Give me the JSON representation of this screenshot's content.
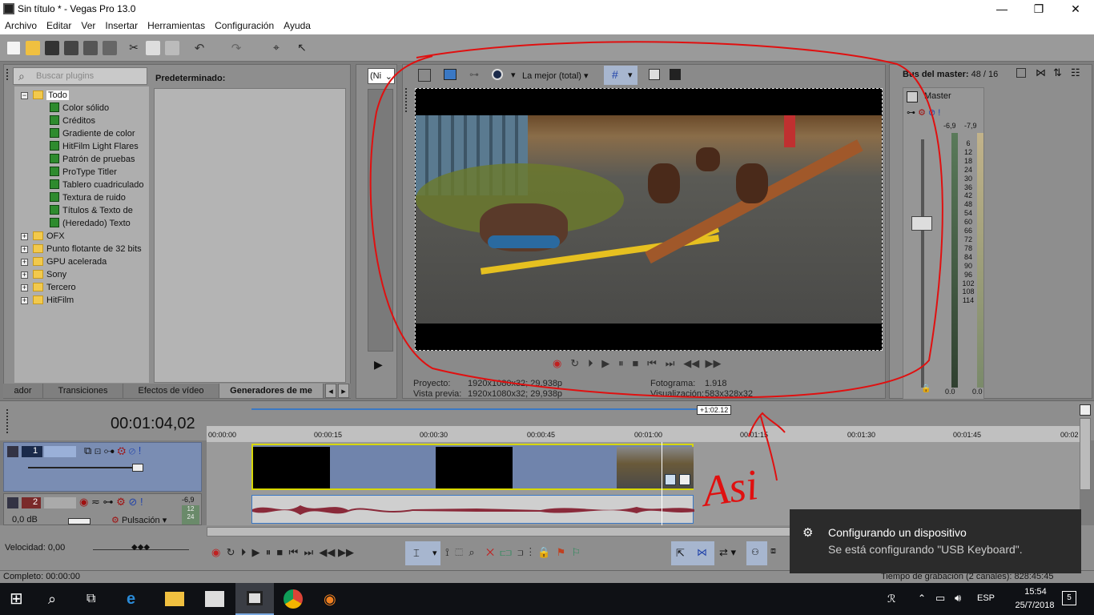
{
  "window": {
    "title": "Sin título * - Vegas Pro 13.0"
  },
  "menu": [
    "Archivo",
    "Editar",
    "Ver",
    "Insertar",
    "Herramientas",
    "Configuración",
    "Ayuda"
  ],
  "explorer": {
    "search_placeholder": "Buscar plugins",
    "preset_label": "Predeterminado:",
    "tree": {
      "root": "Todo",
      "children": [
        "Color sólido",
        "Créditos",
        "Gradiente de color",
        "HitFilm Light Flares",
        "Patrón de pruebas",
        "ProType Titler",
        "Tablero cuadriculado",
        "Textura de ruido",
        "Títulos & Texto de",
        "(Heredado) Texto"
      ],
      "folders": [
        "OFX",
        "Punto flotante de 32 bits",
        "GPU acelerada",
        "Sony",
        "Tercero",
        "HitFilm"
      ]
    },
    "tabs": [
      "ador",
      "Transiciones",
      "Efectos de vídeo",
      "Generadores de me"
    ]
  },
  "trimmer": {
    "dropdown": "(Ni"
  },
  "preview": {
    "quality": "La mejor (total)",
    "proyecto_label": "Proyecto:",
    "proyecto_value": "1920x1080x32; 29,938p",
    "vista_label": "Vista previa:",
    "vista_value": "1920x1080x32; 29,938p",
    "fotograma_label": "Fotograma:",
    "fotograma_value": "1.918",
    "visualizacion_label": "Visualización:",
    "visualizacion_value": "583x328x32"
  },
  "master": {
    "title": "Bus del master:",
    "count": "48 / 16",
    "label": "Master",
    "peak_l": "-6,9",
    "peak_r": "-7,9",
    "scale": [
      "6",
      "12",
      "18",
      "24",
      "30",
      "36",
      "42",
      "48",
      "54",
      "60",
      "66",
      "72",
      "78",
      "84",
      "90",
      "96",
      "102",
      "108",
      "114"
    ],
    "bottom_l": "0.0",
    "bottom_r": "0.0"
  },
  "timeline": {
    "timecode": "00:01:04,02",
    "loop_badge": "+1:02.12",
    "ruler": [
      "00:00:00",
      "00:00:15",
      "00:00:30",
      "00:00:45",
      "00:01:00",
      "00:01:15",
      "00:01:30",
      "00:01:45",
      "00:02"
    ],
    "track1_num": "1",
    "track2_num": "2",
    "track2_vol": "0,0 dB",
    "track2_pan": "Pulsación",
    "track2_meter": "-6,9",
    "track2_m1": "12",
    "track2_m2": "24"
  },
  "bottom": {
    "velocidad": "Velocidad: 0,00",
    "completo": "Completo: 00:00:00",
    "grabacion": "Tiempo de grabación (2 canales): 828:45:45"
  },
  "toast": {
    "title": "Configurando un dispositivo",
    "body": "Se está configurando \"USB Keyboard\"."
  },
  "taskbar": {
    "lang": "ESP",
    "time": "15:54",
    "date": "25/7/2018",
    "notif": "5"
  },
  "annotation": {
    "text": "Asi"
  },
  "colors": {
    "annotation": "#e01010",
    "accent": "#3a78c4"
  }
}
